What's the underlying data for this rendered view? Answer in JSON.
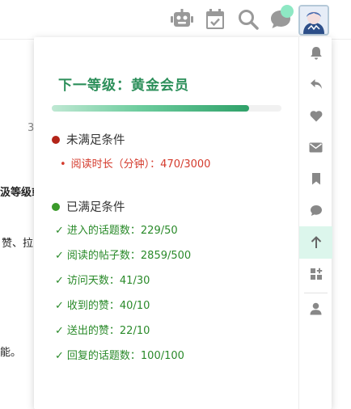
{
  "header": {
    "icons": [
      "robot-icon",
      "calendar-check-icon",
      "search-icon",
      "chat-icon",
      "avatar"
    ],
    "notification_color": "#8ee8c4"
  },
  "background": {
    "fragment_1": "3",
    "fragment_2": "汲等级或",
    "fragment_3": "赞、拉",
    "fragment_4": "能。"
  },
  "panel": {
    "title": "下一等级：黄金会员",
    "progress_fraction": 0.86,
    "unmet": {
      "heading": "未满足条件",
      "items": [
        "阅读时长（分钟）：470/3000"
      ]
    },
    "met": {
      "heading": "已满足条件",
      "items": [
        "进入的话题数：229/50",
        "阅读的帖子数：2859/500",
        "访问天数：41/30",
        "收到的赞：40/10",
        "送出的赞：22/10",
        "回复的话题数：100/100"
      ]
    },
    "check_mark": "✓",
    "bullet": "•"
  },
  "rail": {
    "icons": [
      "bell-icon",
      "reply-icon",
      "heart-icon",
      "envelope-icon",
      "bookmark-icon",
      "chat-bubble-icon",
      "arrow-up-icon",
      "grid-add-icon",
      "user-icon"
    ],
    "active": "arrow-up-icon"
  },
  "colors": {
    "accent": "#2c8f5a",
    "unmet": "#d43b2d",
    "met": "#2a8a2a",
    "active_bg": "#dcf6ec"
  }
}
